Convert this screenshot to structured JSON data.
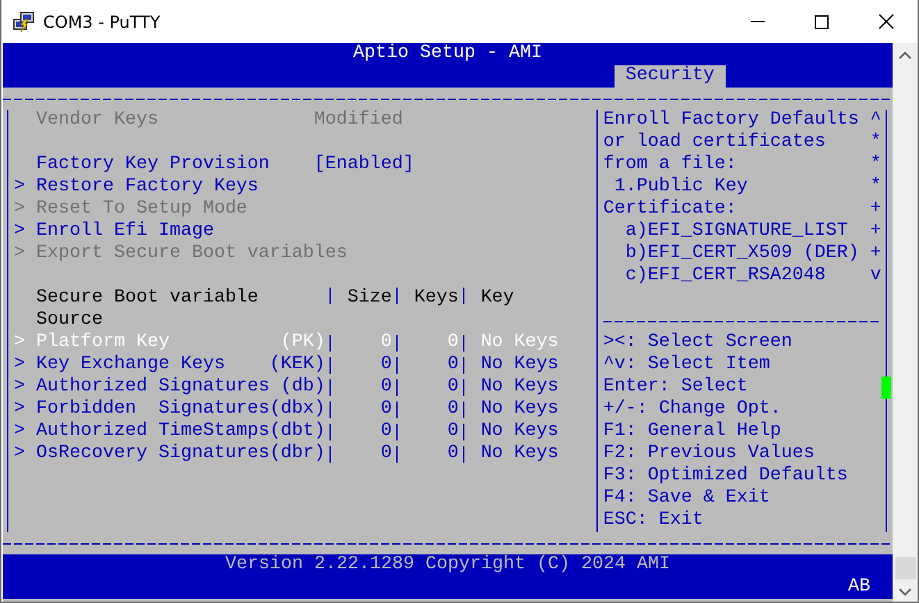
{
  "window": {
    "title": "COM3 - PuTTY"
  },
  "header": {
    "title": "Aptio Setup - AMI",
    "tabs": [
      {
        "label": "Security",
        "selected": true
      }
    ]
  },
  "left_panel": {
    "status": {
      "label": "Vendor Keys",
      "value": "Modified"
    },
    "settings": [
      {
        "label": "Factory Key Provision",
        "value": "[Enabled]"
      }
    ],
    "menu_items": [
      {
        "marker": ">",
        "label": "Restore Factory Keys",
        "disabled": false
      },
      {
        "marker": ">",
        "label": "Reset To Setup Mode",
        "disabled": true
      },
      {
        "marker": ">",
        "label": "Enroll Efi Image",
        "disabled": false
      },
      {
        "marker": ">",
        "label": "Export Secure Boot variables",
        "disabled": true
      }
    ],
    "table": {
      "columns": [
        {
          "lines": [
            "Secure Boot variable"
          ]
        },
        {
          "lines": [
            "Size"
          ]
        },
        {
          "lines": [
            "Keys"
          ]
        },
        {
          "lines": [
            "Key",
            "Source"
          ]
        }
      ],
      "rows": [
        {
          "marker": ">",
          "name": "Platform Key",
          "abbr": "(PK)",
          "size": "0",
          "keys": "0",
          "source": "No Keys",
          "selected": true
        },
        {
          "marker": ">",
          "name": "Key Exchange Keys",
          "abbr": "(KEK)",
          "size": "0",
          "keys": "0",
          "source": "No Keys",
          "selected": false
        },
        {
          "marker": ">",
          "name": "Authorized Signatures",
          "abbr": "(db)",
          "size": "0",
          "keys": "0",
          "source": "No Keys",
          "selected": false
        },
        {
          "marker": ">",
          "name": "Forbidden  Signatures",
          "abbr": "(dbx)",
          "size": "0",
          "keys": "0",
          "source": "No Keys",
          "selected": false
        },
        {
          "marker": ">",
          "name": "Authorized TimeStamps",
          "abbr": "(dbt)",
          "size": "0",
          "keys": "0",
          "source": "No Keys",
          "selected": false
        },
        {
          "marker": ">",
          "name": "OsRecovery Signatures",
          "abbr": "(dbr)",
          "size": "0",
          "keys": "0",
          "source": "No Keys",
          "selected": false
        }
      ]
    }
  },
  "right_panel": {
    "help_lines": [
      {
        "text": "Enroll Factory Defaults",
        "scroll_mark": "^"
      },
      {
        "text": "or load certificates",
        "scroll_mark": "*"
      },
      {
        "text": "from a file:",
        "scroll_mark": "*"
      },
      {
        "text": " 1.Public Key",
        "scroll_mark": "*"
      },
      {
        "text": "Certificate:",
        "scroll_mark": "+"
      },
      {
        "text": "  a)EFI_SIGNATURE_LIST",
        "scroll_mark": "+"
      },
      {
        "text": "  b)EFI_CERT_X509 (DER)",
        "scroll_mark": "+"
      },
      {
        "text": "  c)EFI_CERT_RSA2048",
        "scroll_mark": "v"
      }
    ],
    "key_hints": [
      "><: Select Screen",
      "^v: Select Item",
      "Enter: Select",
      "+/-: Change Opt.",
      "F1: General Help",
      "F2: Previous Values",
      "F3: Optimized Defaults",
      "F4: Save & Exit",
      "ESC: Exit"
    ]
  },
  "footer": {
    "version": "Version 2.22.1289 Copyright (C) 2024 AMI",
    "status": "AB"
  }
}
